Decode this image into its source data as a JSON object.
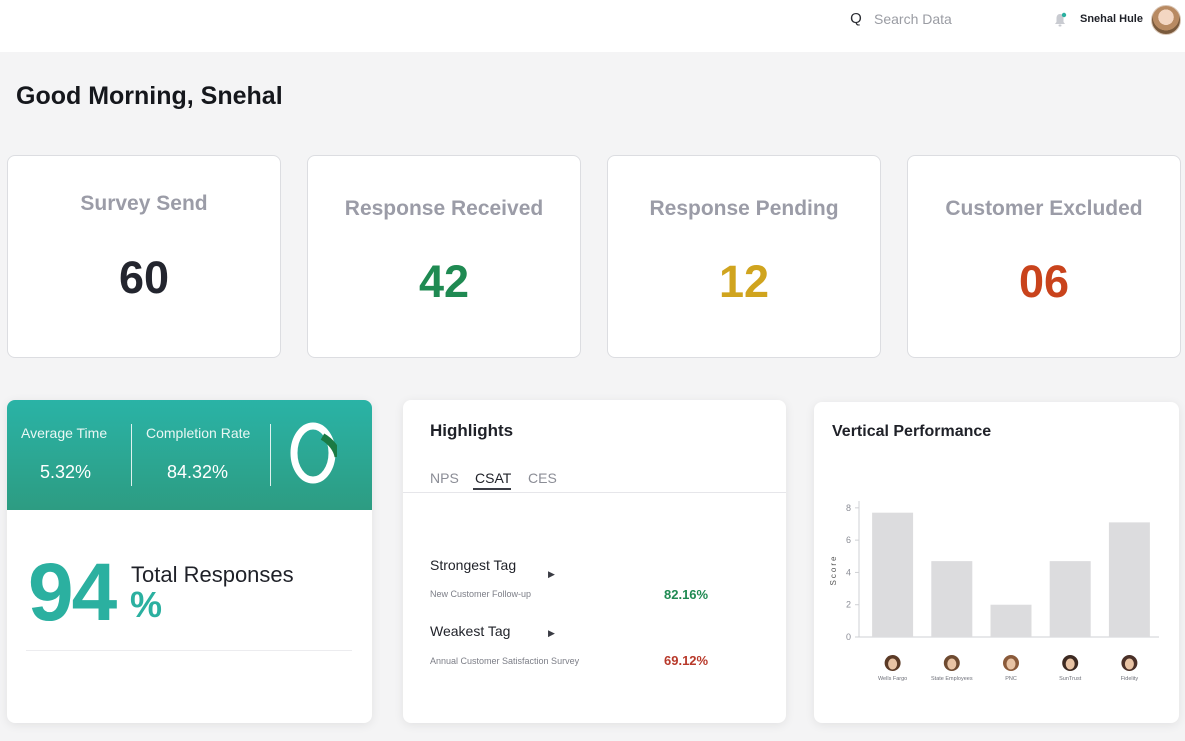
{
  "header": {
    "search_placeholder": "Search Data",
    "search_glyph": "Q",
    "username": "Snehal Hule"
  },
  "greeting": "Good Morning, Snehal",
  "stats": [
    {
      "label": "Survey Send",
      "value": "60",
      "color": "#23252e"
    },
    {
      "label": "Response Received",
      "value": "42",
      "color": "#1f8a52"
    },
    {
      "label": "Response Pending",
      "value": "12",
      "color": "#d0a41e"
    },
    {
      "label": "Customer Excluded",
      "value": "06",
      "color": "#c9431c"
    }
  ],
  "response_card": {
    "avg_time_label": "Average Time",
    "avg_time_value": "5.32%",
    "completion_label": "Completion Rate",
    "completion_value": "84.32%",
    "completion_ring_fraction": 0.18,
    "total_percent": "94",
    "percent_sign": "%",
    "total_label": "Total Responses"
  },
  "highlights": {
    "title": "Highlights",
    "tabs": [
      "NPS",
      "CSAT",
      "CES"
    ],
    "active_tab": "CSAT",
    "strongest_label": "Strongest Tag",
    "strongest_name": "New Customer Follow-up",
    "strongest_value": "82.16%",
    "weakest_label": "Weakest Tag",
    "weakest_name": "Annual Customer Satisfaction Survey",
    "weakest_value": "69.12%",
    "colors": {
      "positive": "#1f8a52",
      "negative": "#b8392a"
    }
  },
  "vertical_performance": {
    "title": "Vertical Performance"
  },
  "chart_data": {
    "type": "bar",
    "categories": [
      "Wells Fargo",
      "State Employees",
      "PNC",
      "SunTrust",
      "Fidelity"
    ],
    "values": [
      7.7,
      4.7,
      2.0,
      4.7,
      7.1
    ],
    "ylabel": "Score",
    "yticks": [
      0,
      2,
      4,
      6,
      8
    ],
    "ylim": [
      0,
      8.3
    ],
    "bar_color": "#dcdcde",
    "grid": false
  }
}
